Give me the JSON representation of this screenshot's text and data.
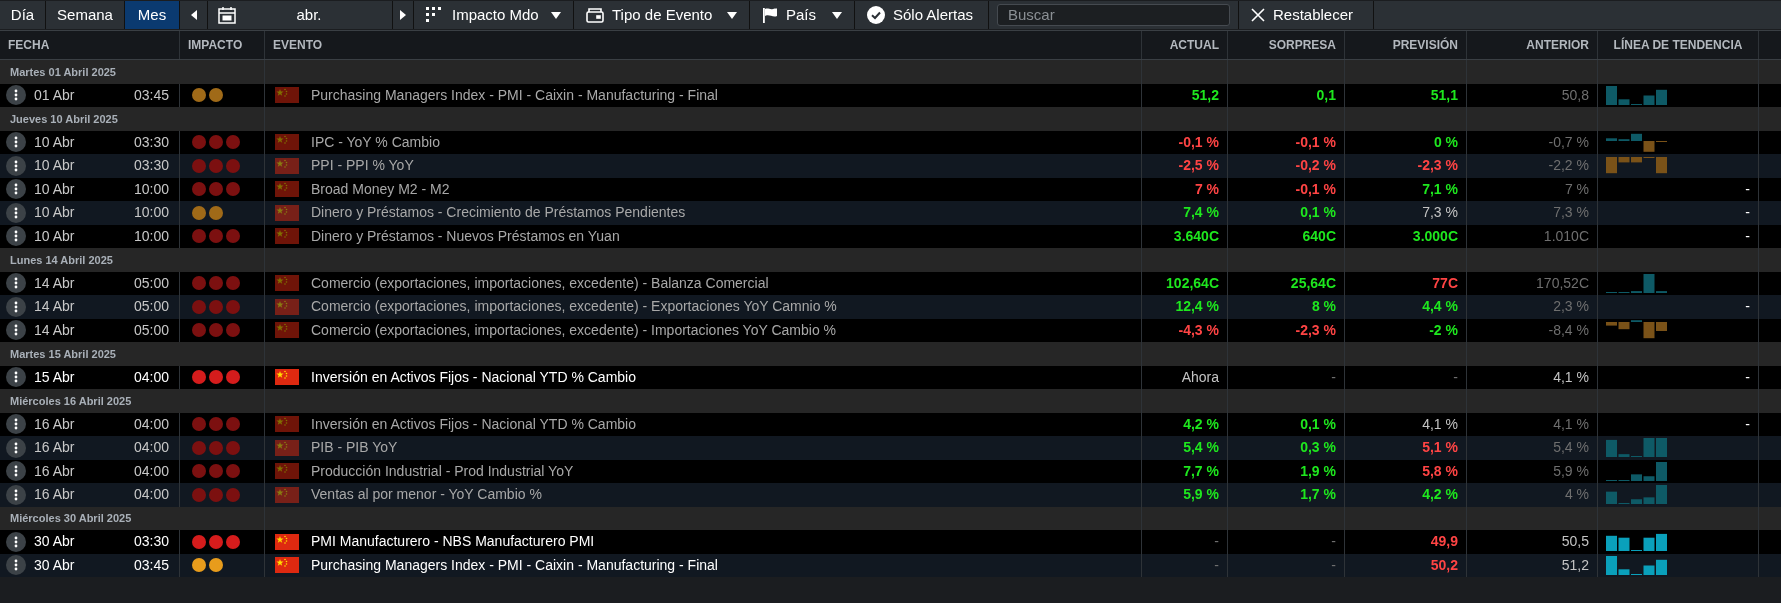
{
  "toolbar": {
    "views": [
      {
        "label": "Día",
        "selected": false
      },
      {
        "label": "Semana",
        "selected": false
      },
      {
        "label": "Mes",
        "selected": true
      }
    ],
    "period": "abr.",
    "filters": [
      {
        "kind": "impact",
        "label": "Impacto Mdo"
      },
      {
        "kind": "type",
        "label": "Tipo de Evento"
      },
      {
        "kind": "country",
        "label": "País"
      }
    ],
    "alerts": "Sólo Alertas",
    "search": {
      "placeholder": "Buscar"
    },
    "reset": "Restablecer"
  },
  "table": {
    "columns": [
      "FECHA",
      "IMPACTO",
      "EVENTO",
      "ACTUAL",
      "SORPRESA",
      "PREVISIÓN",
      "ANTERIOR",
      "LÍNEA DE TENDENCIA"
    ],
    "rows": [
      {
        "kind": "group",
        "label": "Martes 01 Abril 2025"
      },
      {
        "kind": "event",
        "past": true,
        "date": "01 Abr",
        "time": "03:45",
        "high_impact": false,
        "event": "Purchasing Managers Index - PMI - Caixin - Manufacturing - Final",
        "actual": {
          "text": "51,2",
          "kind": "positive"
        },
        "surprise": {
          "text": "0,1",
          "kind": "positive"
        },
        "forecast": {
          "text": "51,1",
          "kind": "positive"
        },
        "previous": {
          "text": "50,8",
          "kind": "muted"
        },
        "trend": {
          "kind": "bars"
        }
      },
      {
        "kind": "group",
        "label": "Jueves 10 Abril 2025"
      },
      {
        "kind": "event",
        "past": true,
        "date": "10 Abr",
        "time": "03:30",
        "high_impact": true,
        "event": "IPC - YoY % Cambio",
        "actual": {
          "text": "-0,1 %",
          "kind": "negative"
        },
        "surprise": {
          "text": "-0,1 %",
          "kind": "negative"
        },
        "forecast": {
          "text": "0 %",
          "kind": "positive"
        },
        "previous": {
          "text": "-0,7 %",
          "kind": "muted"
        },
        "trend": {
          "kind": "bars"
        }
      },
      {
        "kind": "event",
        "past": true,
        "date": "10 Abr",
        "time": "03:30",
        "high_impact": true,
        "event": "PPI - PPI % YoY",
        "actual": {
          "text": "-2,5 %",
          "kind": "negative"
        },
        "surprise": {
          "text": "-0,2 %",
          "kind": "negative"
        },
        "forecast": {
          "text": "-2,3 %",
          "kind": "negative"
        },
        "previous": {
          "text": "-2,2 %",
          "kind": "muted"
        },
        "trend": {
          "kind": "bars"
        }
      },
      {
        "kind": "event",
        "past": true,
        "date": "10 Abr",
        "time": "10:00",
        "high_impact": true,
        "event": "Broad Money M2 - M2",
        "actual": {
          "text": "7 %",
          "kind": "negative"
        },
        "surprise": {
          "text": "-0,1 %",
          "kind": "negative"
        },
        "forecast": {
          "text": "7,1 %",
          "kind": "positive"
        },
        "previous": {
          "text": "7 %",
          "kind": "muted"
        },
        "trend": {
          "kind": "dash",
          "text": "-"
        }
      },
      {
        "kind": "event",
        "past": true,
        "date": "10 Abr",
        "time": "10:00",
        "high_impact": false,
        "event": "Dinero y Préstamos - Crecimiento de Préstamos Pendientes",
        "actual": {
          "text": "7,4 %",
          "kind": "positive"
        },
        "surprise": {
          "text": "0,1 %",
          "kind": "positive"
        },
        "forecast": {
          "text": "7,3 %",
          "kind": "neutral"
        },
        "previous": {
          "text": "7,3 %",
          "kind": "muted"
        },
        "trend": {
          "kind": "dash",
          "text": "-"
        }
      },
      {
        "kind": "event",
        "past": true,
        "date": "10 Abr",
        "time": "10:00",
        "high_impact": true,
        "event": "Dinero y Préstamos - Nuevos Préstamos en Yuan",
        "actual": {
          "text": "3.640C",
          "kind": "positive"
        },
        "surprise": {
          "text": "640C",
          "kind": "positive"
        },
        "forecast": {
          "text": "3.000C",
          "kind": "positive"
        },
        "previous": {
          "text": "1.010C",
          "kind": "muted"
        },
        "trend": {
          "kind": "dash",
          "text": "-"
        }
      },
      {
        "kind": "group",
        "label": "Lunes 14 Abril 2025"
      },
      {
        "kind": "event",
        "past": true,
        "date": "14 Abr",
        "time": "05:00",
        "high_impact": true,
        "event": "Comercio (exportaciones, importaciones, excedente) - Balanza Comercial",
        "actual": {
          "text": "102,64C",
          "kind": "positive"
        },
        "surprise": {
          "text": "25,64C",
          "kind": "positive"
        },
        "forecast": {
          "text": "77C",
          "kind": "negative"
        },
        "previous": {
          "text": "170,52C",
          "kind": "muted"
        },
        "trend": {
          "kind": "bars"
        }
      },
      {
        "kind": "event",
        "past": true,
        "date": "14 Abr",
        "time": "05:00",
        "high_impact": true,
        "event": "Comercio (exportaciones, importaciones, excedente) - Exportaciones YoY Camnio %",
        "actual": {
          "text": "12,4 %",
          "kind": "positive"
        },
        "surprise": {
          "text": "8 %",
          "kind": "positive"
        },
        "forecast": {
          "text": "4,4 %",
          "kind": "positive"
        },
        "previous": {
          "text": "2,3 %",
          "kind": "muted"
        },
        "trend": {
          "kind": "dash",
          "text": "-"
        }
      },
      {
        "kind": "event",
        "past": true,
        "date": "14 Abr",
        "time": "05:00",
        "high_impact": true,
        "event": "Comercio (exportaciones, importaciones, excedente) - Importaciones YoY Cambio %",
        "actual": {
          "text": "-4,3 %",
          "kind": "negative"
        },
        "surprise": {
          "text": "-2,3 %",
          "kind": "negative"
        },
        "forecast": {
          "text": "-2 %",
          "kind": "positive"
        },
        "previous": {
          "text": "-8,4 %",
          "kind": "muted"
        },
        "trend": {
          "kind": "bars"
        }
      },
      {
        "kind": "group",
        "label": "Martes 15 Abril 2025"
      },
      {
        "kind": "event",
        "past": false,
        "date": "15 Abr",
        "time": "04:00",
        "high_impact": true,
        "event": "Inversión en Activos Fijos - Nacional YTD % Cambio",
        "actual": {
          "text": "Ahora",
          "kind": "neutral"
        },
        "surprise": {
          "text": "-",
          "kind": "muted"
        },
        "forecast": {
          "text": "-",
          "kind": "muted"
        },
        "previous": {
          "text": "4,1 %",
          "kind": "neutral"
        },
        "trend": {
          "kind": "dash",
          "text": "-"
        }
      },
      {
        "kind": "group",
        "label": "Miércoles 16 Abril 2025"
      },
      {
        "kind": "event",
        "past": true,
        "date": "16 Abr",
        "time": "04:00",
        "high_impact": true,
        "event": "Inversión en Activos Fijos - Nacional YTD % Cambio",
        "actual": {
          "text": "4,2 %",
          "kind": "positive"
        },
        "surprise": {
          "text": "0,1 %",
          "kind": "positive"
        },
        "forecast": {
          "text": "4,1 %",
          "kind": "neutral"
        },
        "previous": {
          "text": "4,1 %",
          "kind": "muted"
        },
        "trend": {
          "kind": "dash",
          "text": "-"
        }
      },
      {
        "kind": "event",
        "past": true,
        "date": "16 Abr",
        "time": "04:00",
        "high_impact": true,
        "event": "PIB - PIB YoY",
        "actual": {
          "text": "5,4 %",
          "kind": "positive"
        },
        "surprise": {
          "text": "0,3 %",
          "kind": "positive"
        },
        "forecast": {
          "text": "5,1 %",
          "kind": "negative"
        },
        "previous": {
          "text": "5,4 %",
          "kind": "muted"
        },
        "trend": {
          "kind": "bars"
        }
      },
      {
        "kind": "event",
        "past": true,
        "date": "16 Abr",
        "time": "04:00",
        "high_impact": true,
        "event": "Producción Industrial - Prod Industrial YoY",
        "actual": {
          "text": "7,7 %",
          "kind": "positive"
        },
        "surprise": {
          "text": "1,9 %",
          "kind": "positive"
        },
        "forecast": {
          "text": "5,8 %",
          "kind": "negative"
        },
        "previous": {
          "text": "5,9 %",
          "kind": "muted"
        },
        "trend": {
          "kind": "bars"
        }
      },
      {
        "kind": "event",
        "past": true,
        "date": "16 Abr",
        "time": "04:00",
        "high_impact": true,
        "event": "Ventas al por menor - YoY Cambio %",
        "actual": {
          "text": "5,9 %",
          "kind": "positive"
        },
        "surprise": {
          "text": "1,7 %",
          "kind": "positive"
        },
        "forecast": {
          "text": "4,2 %",
          "kind": "positive"
        },
        "previous": {
          "text": "4 %",
          "kind": "muted"
        },
        "trend": {
          "kind": "bars"
        }
      },
      {
        "kind": "group",
        "label": "Miércoles 30 Abril 2025"
      },
      {
        "kind": "event",
        "past": false,
        "date": "30 Abr",
        "time": "03:30",
        "high_impact": true,
        "event": "PMI Manufacturero - NBS Manufacturero PMI",
        "actual": {
          "text": "-",
          "kind": "muted"
        },
        "surprise": {
          "text": "-",
          "kind": "muted"
        },
        "forecast": {
          "text": "49,9",
          "kind": "negative"
        },
        "previous": {
          "text": "50,5",
          "kind": "neutral"
        },
        "trend": {
          "kind": "bars"
        }
      },
      {
        "kind": "event",
        "past": false,
        "date": "30 Abr",
        "time": "03:45",
        "high_impact": false,
        "event": "Purchasing Managers Index - PMI - Caixin - Manufacturing - Final",
        "actual": {
          "text": "-",
          "kind": "muted"
        },
        "surprise": {
          "text": "-",
          "kind": "muted"
        },
        "forecast": {
          "text": "50,2",
          "kind": "negative"
        },
        "previous": {
          "text": "51,2",
          "kind": "neutral"
        },
        "trend": {
          "kind": "bars"
        }
      }
    ]
  }
}
